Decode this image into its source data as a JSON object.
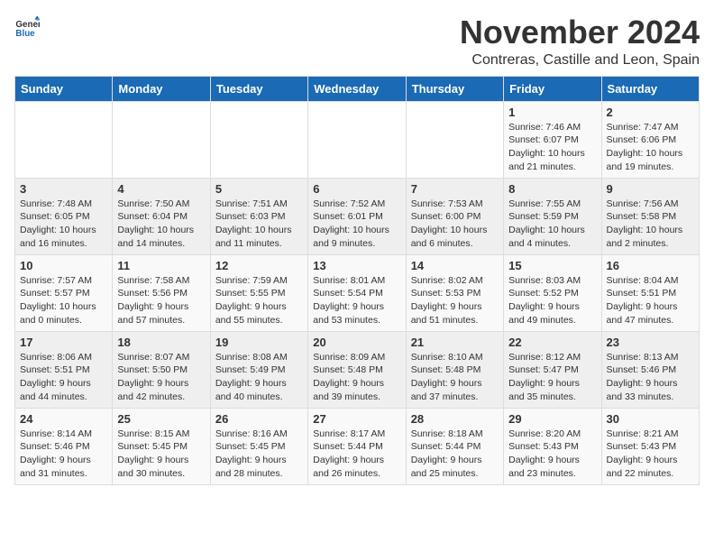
{
  "header": {
    "logo_general": "General",
    "logo_blue": "Blue",
    "month_title": "November 2024",
    "location": "Contreras, Castille and Leon, Spain"
  },
  "calendar": {
    "weekdays": [
      "Sunday",
      "Monday",
      "Tuesday",
      "Wednesday",
      "Thursday",
      "Friday",
      "Saturday"
    ],
    "weeks": [
      [
        {
          "day": "",
          "info": ""
        },
        {
          "day": "",
          "info": ""
        },
        {
          "day": "",
          "info": ""
        },
        {
          "day": "",
          "info": ""
        },
        {
          "day": "",
          "info": ""
        },
        {
          "day": "1",
          "info": "Sunrise: 7:46 AM\nSunset: 6:07 PM\nDaylight: 10 hours\nand 21 minutes."
        },
        {
          "day": "2",
          "info": "Sunrise: 7:47 AM\nSunset: 6:06 PM\nDaylight: 10 hours\nand 19 minutes."
        }
      ],
      [
        {
          "day": "3",
          "info": "Sunrise: 7:48 AM\nSunset: 6:05 PM\nDaylight: 10 hours\nand 16 minutes."
        },
        {
          "day": "4",
          "info": "Sunrise: 7:50 AM\nSunset: 6:04 PM\nDaylight: 10 hours\nand 14 minutes."
        },
        {
          "day": "5",
          "info": "Sunrise: 7:51 AM\nSunset: 6:03 PM\nDaylight: 10 hours\nand 11 minutes."
        },
        {
          "day": "6",
          "info": "Sunrise: 7:52 AM\nSunset: 6:01 PM\nDaylight: 10 hours\nand 9 minutes."
        },
        {
          "day": "7",
          "info": "Sunrise: 7:53 AM\nSunset: 6:00 PM\nDaylight: 10 hours\nand 6 minutes."
        },
        {
          "day": "8",
          "info": "Sunrise: 7:55 AM\nSunset: 5:59 PM\nDaylight: 10 hours\nand 4 minutes."
        },
        {
          "day": "9",
          "info": "Sunrise: 7:56 AM\nSunset: 5:58 PM\nDaylight: 10 hours\nand 2 minutes."
        }
      ],
      [
        {
          "day": "10",
          "info": "Sunrise: 7:57 AM\nSunset: 5:57 PM\nDaylight: 10 hours\nand 0 minutes."
        },
        {
          "day": "11",
          "info": "Sunrise: 7:58 AM\nSunset: 5:56 PM\nDaylight: 9 hours\nand 57 minutes."
        },
        {
          "day": "12",
          "info": "Sunrise: 7:59 AM\nSunset: 5:55 PM\nDaylight: 9 hours\nand 55 minutes."
        },
        {
          "day": "13",
          "info": "Sunrise: 8:01 AM\nSunset: 5:54 PM\nDaylight: 9 hours\nand 53 minutes."
        },
        {
          "day": "14",
          "info": "Sunrise: 8:02 AM\nSunset: 5:53 PM\nDaylight: 9 hours\nand 51 minutes."
        },
        {
          "day": "15",
          "info": "Sunrise: 8:03 AM\nSunset: 5:52 PM\nDaylight: 9 hours\nand 49 minutes."
        },
        {
          "day": "16",
          "info": "Sunrise: 8:04 AM\nSunset: 5:51 PM\nDaylight: 9 hours\nand 47 minutes."
        }
      ],
      [
        {
          "day": "17",
          "info": "Sunrise: 8:06 AM\nSunset: 5:51 PM\nDaylight: 9 hours\nand 44 minutes."
        },
        {
          "day": "18",
          "info": "Sunrise: 8:07 AM\nSunset: 5:50 PM\nDaylight: 9 hours\nand 42 minutes."
        },
        {
          "day": "19",
          "info": "Sunrise: 8:08 AM\nSunset: 5:49 PM\nDaylight: 9 hours\nand 40 minutes."
        },
        {
          "day": "20",
          "info": "Sunrise: 8:09 AM\nSunset: 5:48 PM\nDaylight: 9 hours\nand 39 minutes."
        },
        {
          "day": "21",
          "info": "Sunrise: 8:10 AM\nSunset: 5:48 PM\nDaylight: 9 hours\nand 37 minutes."
        },
        {
          "day": "22",
          "info": "Sunrise: 8:12 AM\nSunset: 5:47 PM\nDaylight: 9 hours\nand 35 minutes."
        },
        {
          "day": "23",
          "info": "Sunrise: 8:13 AM\nSunset: 5:46 PM\nDaylight: 9 hours\nand 33 minutes."
        }
      ],
      [
        {
          "day": "24",
          "info": "Sunrise: 8:14 AM\nSunset: 5:46 PM\nDaylight: 9 hours\nand 31 minutes."
        },
        {
          "day": "25",
          "info": "Sunrise: 8:15 AM\nSunset: 5:45 PM\nDaylight: 9 hours\nand 30 minutes."
        },
        {
          "day": "26",
          "info": "Sunrise: 8:16 AM\nSunset: 5:45 PM\nDaylight: 9 hours\nand 28 minutes."
        },
        {
          "day": "27",
          "info": "Sunrise: 8:17 AM\nSunset: 5:44 PM\nDaylight: 9 hours\nand 26 minutes."
        },
        {
          "day": "28",
          "info": "Sunrise: 8:18 AM\nSunset: 5:44 PM\nDaylight: 9 hours\nand 25 minutes."
        },
        {
          "day": "29",
          "info": "Sunrise: 8:20 AM\nSunset: 5:43 PM\nDaylight: 9 hours\nand 23 minutes."
        },
        {
          "day": "30",
          "info": "Sunrise: 8:21 AM\nSunset: 5:43 PM\nDaylight: 9 hours\nand 22 minutes."
        }
      ]
    ]
  }
}
